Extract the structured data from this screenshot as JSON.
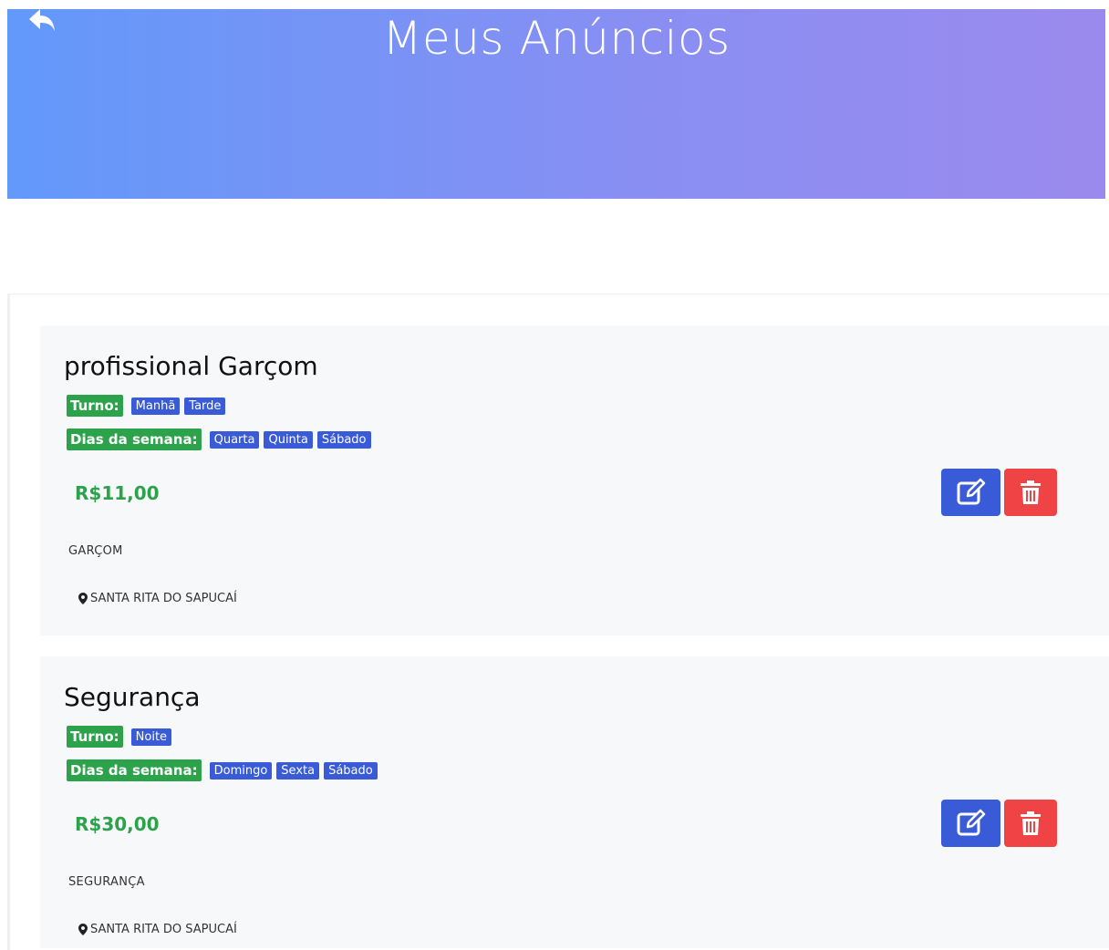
{
  "header": {
    "title": "Meus Anúncios",
    "back_icon": "back-arrow-icon"
  },
  "labels": {
    "turno": "Turno:",
    "dias": "Dias da semana:"
  },
  "ads": [
    {
      "title": "profissional Garçom",
      "turnos": [
        "Manhã",
        "Tarde"
      ],
      "dias": [
        "Quarta",
        "Quinta",
        "Sábado"
      ],
      "price": "R$11,00",
      "category": "GARÇOM",
      "location": "SANTA RITA DO SAPUCAÍ"
    },
    {
      "title": "Segurança",
      "turnos": [
        "Noite"
      ],
      "dias": [
        "Domingo",
        "Sexta",
        "Sábado"
      ],
      "price": "R$30,00",
      "category": "SEGURANÇA",
      "location": "SANTA RITA DO SAPUCAÍ"
    }
  ],
  "colors": {
    "header_start": "#6299fa",
    "header_end": "#9b8aee",
    "label_green": "#2ca24b",
    "tag_blue": "#3a5bd7",
    "edit_blue": "#3a5bd7",
    "delete_red": "#f04346"
  }
}
